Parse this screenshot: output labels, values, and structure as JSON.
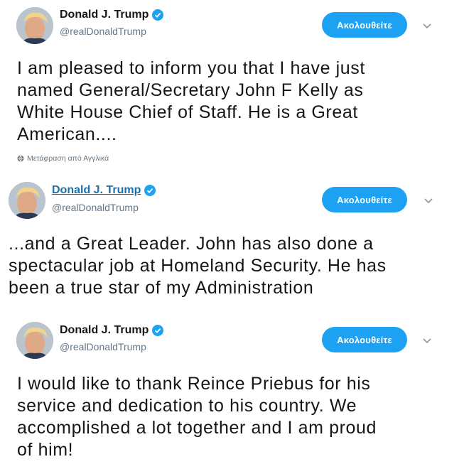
{
  "tweets": [
    {
      "name": "Donald J. Trump",
      "handle": "@realDonaldTrump",
      "follow_label": "Ακολουθείτε",
      "lines": [
        "I am pleased to inform you that I have just",
        "named General/Secretary John F Kelly as",
        "White House Chief of Staff. He is a Great",
        "American...."
      ],
      "translate": "Μετάφραση από Αγγλικά"
    },
    {
      "name": "Donald J. Trump",
      "handle": "@realDonaldTrump",
      "follow_label": "Ακολουθείτε",
      "lines": [
        "...and a Great Leader. John has also done a",
        "spectacular job at Homeland Security. He has",
        "been a true star of my Administration"
      ]
    },
    {
      "name": "Donald J. Trump",
      "handle": "@realDonaldTrump",
      "follow_label": "Ακολουθείτε",
      "lines": [
        "I would like to thank Reince Priebus for his",
        "service and dedication to his country. We",
        "accomplished a lot together and I am proud",
        "of him!"
      ]
    }
  ],
  "icons": {
    "verified": "verified-badge-icon",
    "menu": "chevron-down-icon",
    "translate": "globe-icon"
  },
  "colors": {
    "follow_button": "#1da1f2",
    "verified": "#1da1f2",
    "handle": "#657786",
    "link_name": "#1b6fa8"
  }
}
